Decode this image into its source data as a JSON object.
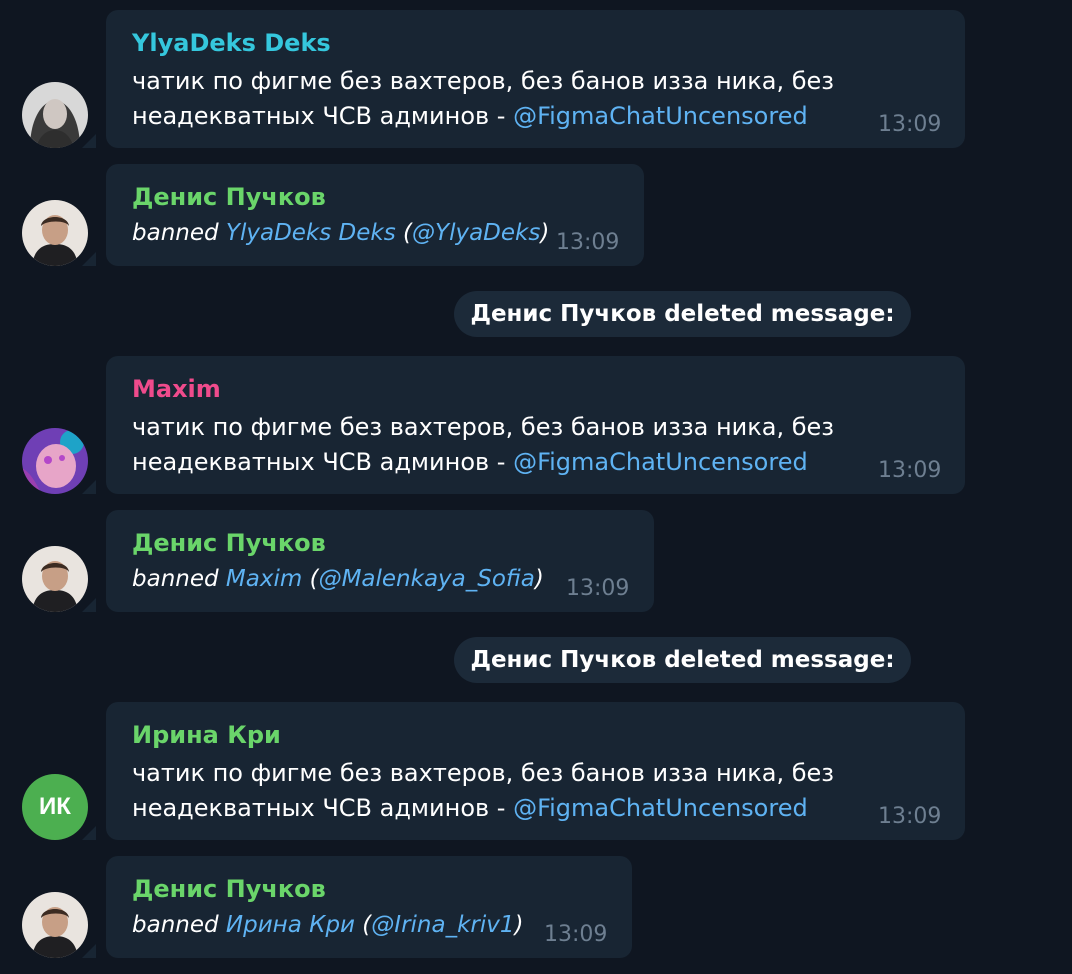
{
  "messages": [
    {
      "sender": "YlyaDeks Deks",
      "sender_color": "#35c7dd",
      "line1": "чатик по фигме без вахтеров, без банов изза ника, без",
      "line2_text": "неадекватных ЧСВ админов - ",
      "line2_link": "@FigmaChatUncensored",
      "time": "13:09"
    },
    {
      "sender": "Денис Пучков",
      "sender_color": "#6ad56a",
      "action": "banned ",
      "target": "YlyaDeks Deks",
      "handle_open": " (",
      "handle": "@YlyaDeks",
      "handle_close": ")",
      "time": "13:09"
    },
    {
      "service": "Денис Пучков deleted message:"
    },
    {
      "sender": "Maxim",
      "sender_color": "#ef4b8c",
      "line1": "чатик по фигме без вахтеров, без банов изза ника, без",
      "line2_text": "неадекватных ЧСВ админов - ",
      "line2_link": "@FigmaChatUncensored",
      "time": "13:09"
    },
    {
      "sender": "Денис Пучков",
      "sender_color": "#6ad56a",
      "action": "banned ",
      "target": "Maxim",
      "handle_open": " (",
      "handle": "@Malenkaya_Sofia",
      "handle_close": ")",
      "time": "13:09"
    },
    {
      "service": "Денис Пучков deleted message:"
    },
    {
      "sender": "Ирина Кри",
      "sender_color": "#6ad56a",
      "avatar_initials": "ИК",
      "line1": "чатик по фигме без вахтеров, без банов изза ника, без",
      "line2_text": "неадекватных ЧСВ админов - ",
      "line2_link": "@FigmaChatUncensored",
      "time": "13:09"
    },
    {
      "sender": "Денис Пучков",
      "sender_color": "#6ad56a",
      "action": "banned ",
      "target": "Ирина Кри",
      "handle_open": " (",
      "handle": "@Irina_kriv1",
      "handle_close": ")",
      "time": "13:09"
    }
  ]
}
